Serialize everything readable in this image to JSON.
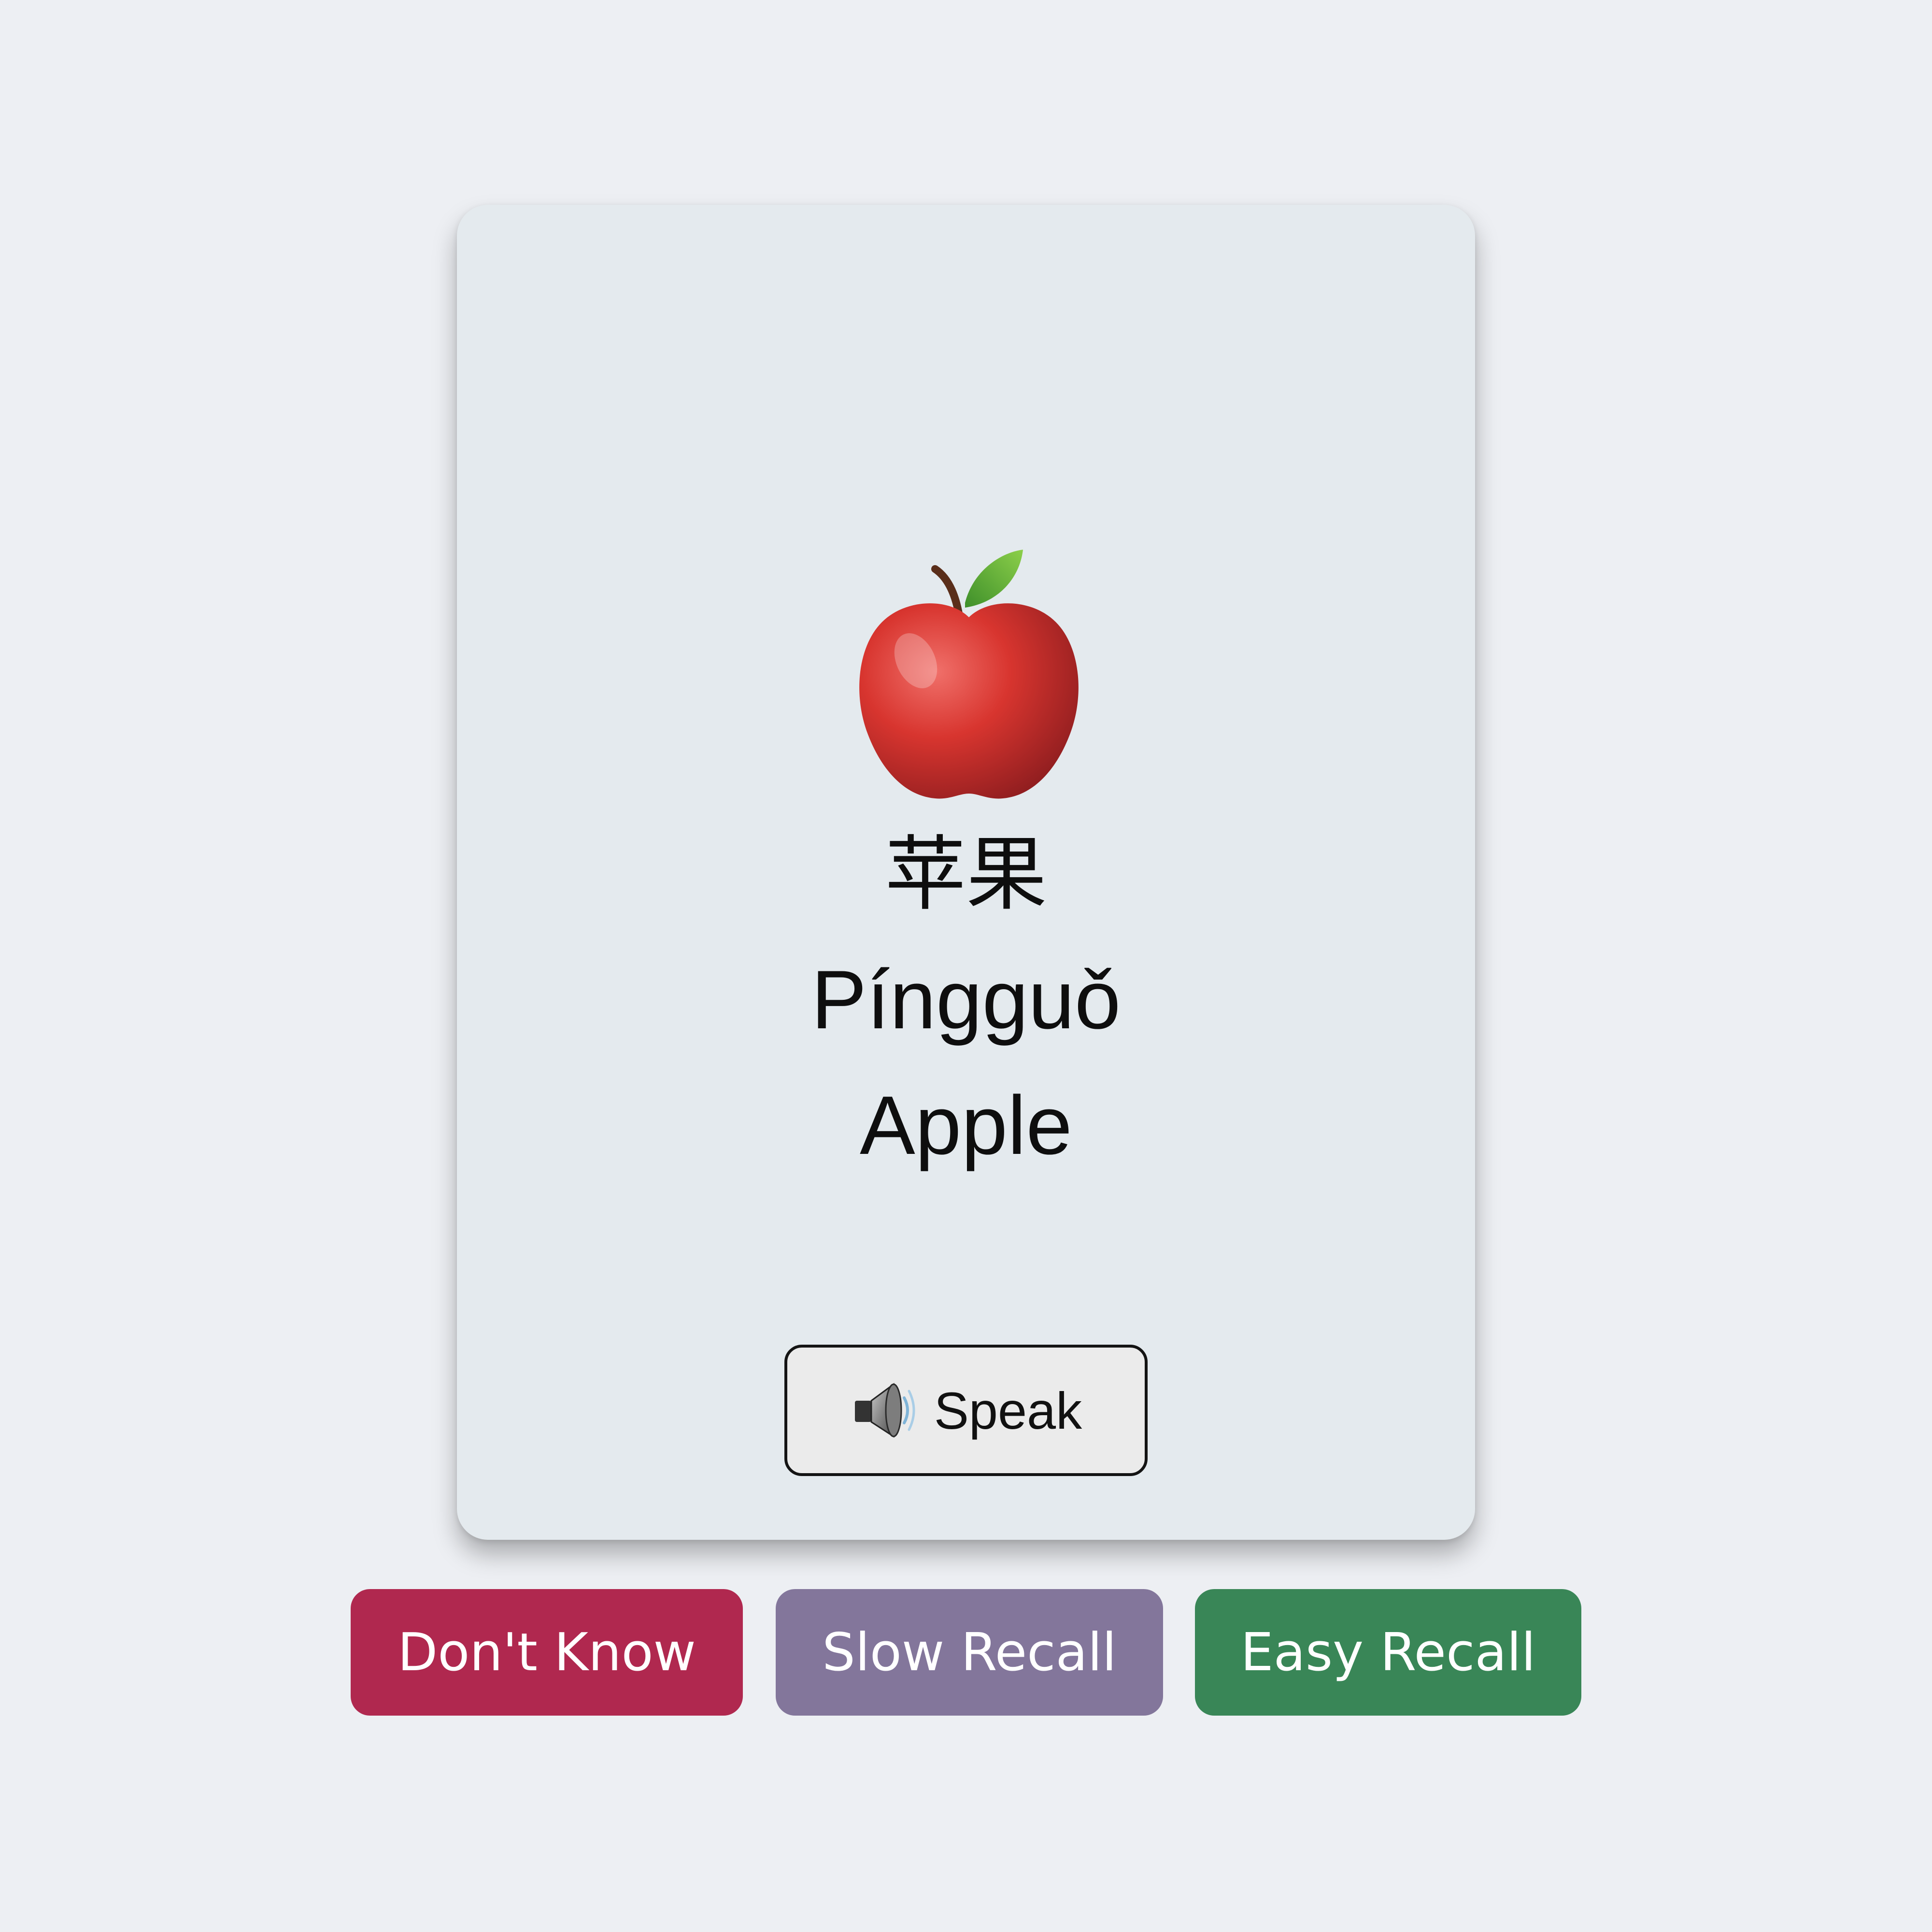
{
  "card": {
    "image_icon": "red-apple-emoji",
    "hanzi": "苹果",
    "pinyin": "Píngguǒ",
    "english": "Apple",
    "speak_icon": "speaker-icon",
    "speak_label": "Speak"
  },
  "ratings": {
    "dont_know_label": "Don't Know",
    "slow_recall_label": "Slow Recall",
    "easy_recall_label": "Easy Recall"
  },
  "colors": {
    "background": "#edeff3",
    "card": "#e4eaee",
    "dont_know": "#b0284f",
    "slow_recall": "#83769b",
    "easy_recall": "#398657"
  }
}
